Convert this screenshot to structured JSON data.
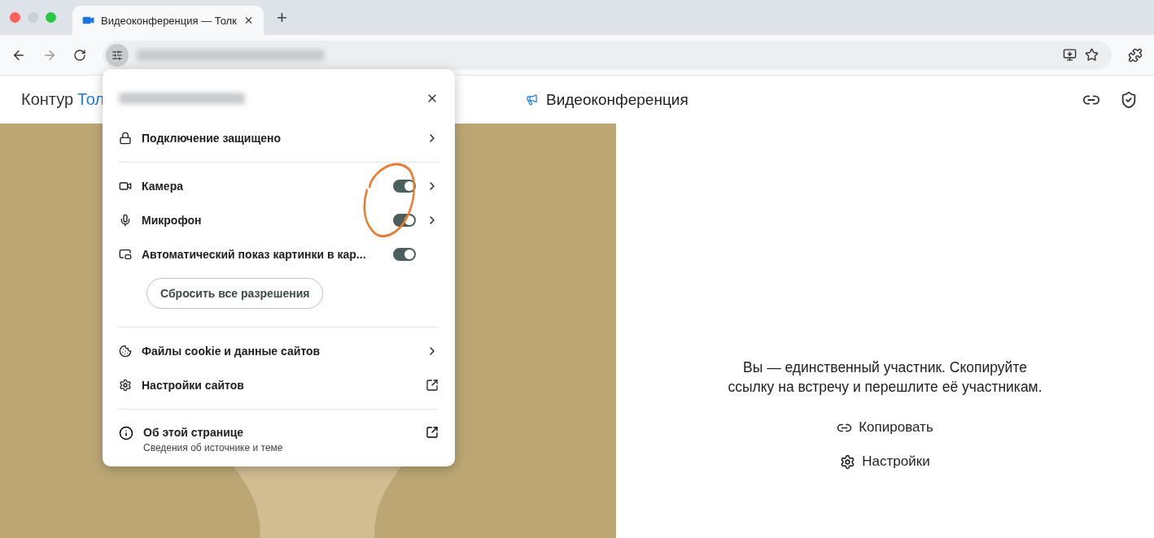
{
  "browser": {
    "tab": {
      "title": "Видеоконференция — Толк",
      "selected": true
    },
    "new_tab": "+"
  },
  "header": {
    "logo_first": "Контур",
    "logo_second": "Тол",
    "title": "Видеоконференция"
  },
  "popup": {
    "connection": "Подключение защищено",
    "permissions": [
      {
        "label": "Камера",
        "on": true,
        "has_details": true
      },
      {
        "label": "Микрофон",
        "on": true,
        "has_details": true
      },
      {
        "label": "Автоматический показ картинки в кар...",
        "on": true,
        "has_details": false
      }
    ],
    "reset_button": "Сбросить все разрешения",
    "cookies": "Файлы cookie и данные сайтов",
    "site_settings": "Настройки сайтов",
    "about": {
      "title": "Об этой странице",
      "subtitle": "Сведения об источнике и теме"
    }
  },
  "meeting": {
    "message": "Вы — единственный участник. Скопируйте ссылку на встречу и перешлите её участникам.",
    "copy": "Копировать",
    "settings": "Настройки"
  }
}
